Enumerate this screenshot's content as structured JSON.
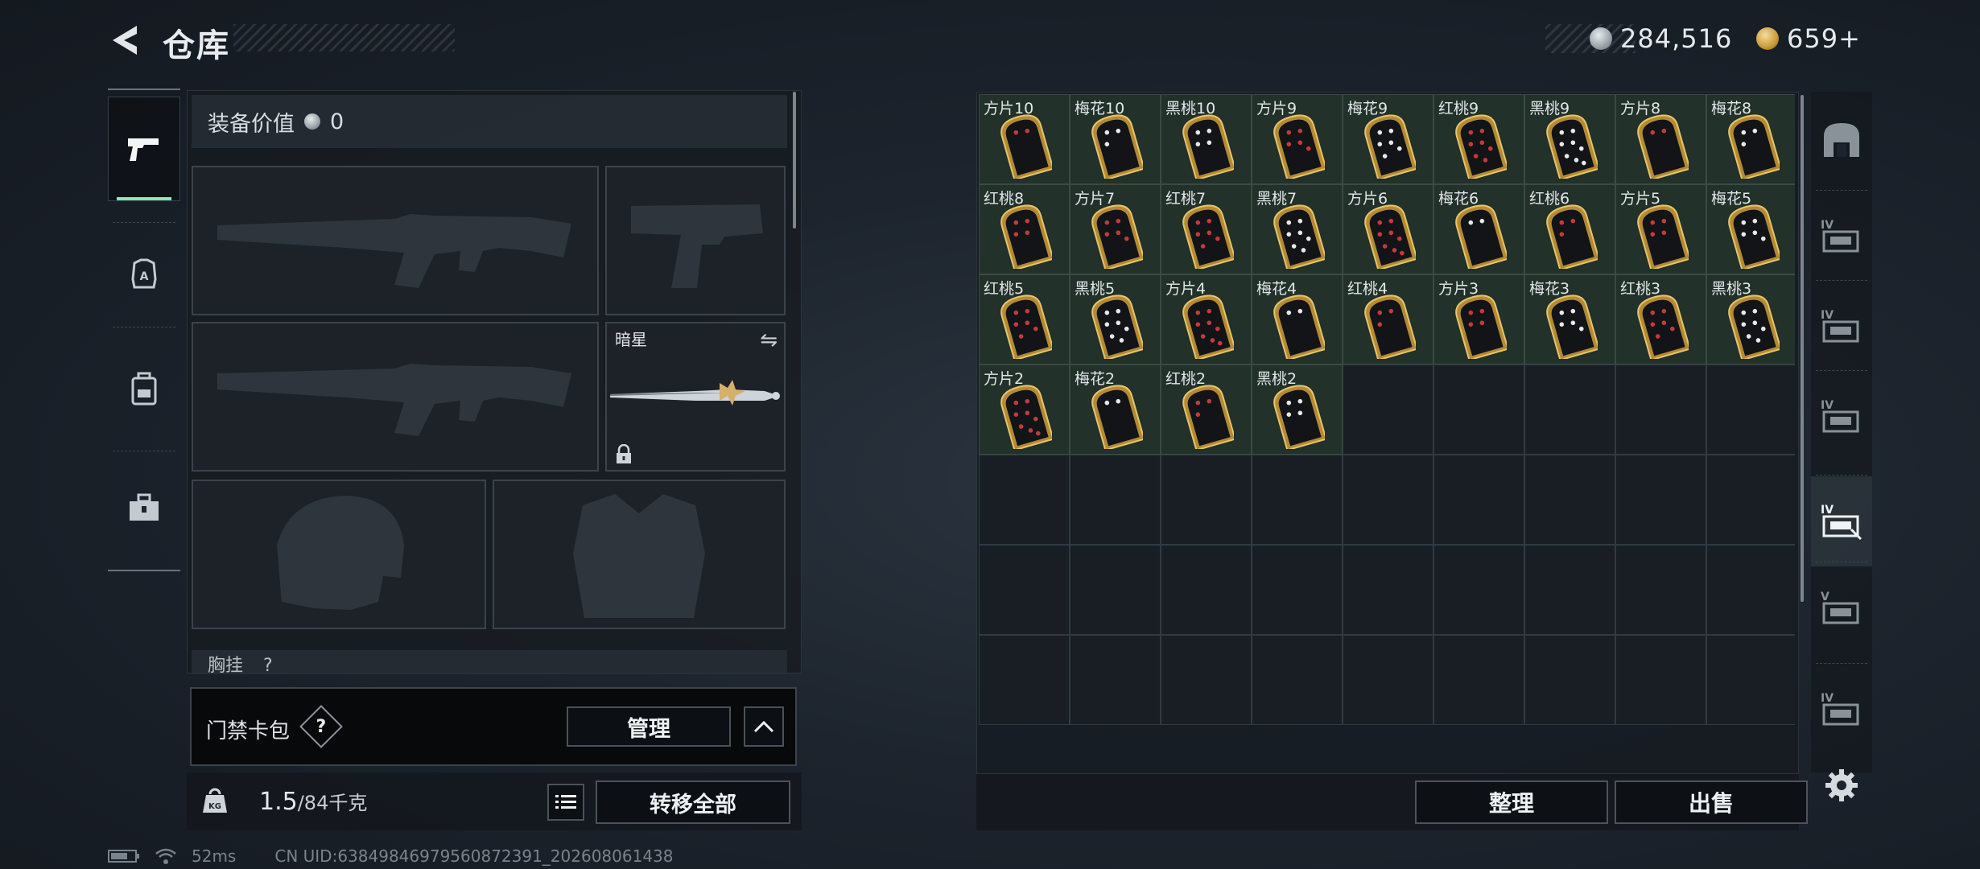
{
  "header": {
    "title": "仓库",
    "currency_silver": "284,516",
    "currency_gold": "659+"
  },
  "sidebar": {
    "items": [
      {
        "name": "weapons",
        "icon": "pistol-icon",
        "active": true
      },
      {
        "name": "armor",
        "icon": "armor-badge-icon",
        "active": false
      },
      {
        "name": "backpack",
        "icon": "backpack-icon",
        "active": false
      },
      {
        "name": "supplies",
        "icon": "toolbox-icon",
        "active": false
      }
    ]
  },
  "equipment": {
    "value_label": "装备价值",
    "value": "0",
    "melee_name": "暗星",
    "chest_label": "胸挂",
    "chest_help": "?"
  },
  "keycard_bag": {
    "label": "门禁卡包",
    "help": "?",
    "manage_label": "管理"
  },
  "weight": {
    "current": "1.5",
    "max_text": "/84千克",
    "transfer_all_label": "转移全部"
  },
  "storage": {
    "columns": 9,
    "total_cells": 63,
    "items": [
      {
        "name": "方片10",
        "suit": "diamond"
      },
      {
        "name": "梅花10",
        "suit": "club"
      },
      {
        "name": "黑桃10",
        "suit": "spade"
      },
      {
        "name": "方片9",
        "suit": "diamond"
      },
      {
        "name": "梅花9",
        "suit": "club"
      },
      {
        "name": "红桃9",
        "suit": "heart"
      },
      {
        "name": "黑桃9",
        "suit": "spade"
      },
      {
        "name": "方片8",
        "suit": "diamond"
      },
      {
        "name": "梅花8",
        "suit": "club"
      },
      {
        "name": "红桃8",
        "suit": "heart"
      },
      {
        "name": "方片7",
        "suit": "diamond"
      },
      {
        "name": "红桃7",
        "suit": "heart"
      },
      {
        "name": "黑桃7",
        "suit": "spade"
      },
      {
        "name": "方片6",
        "suit": "diamond"
      },
      {
        "name": "梅花6",
        "suit": "club"
      },
      {
        "name": "红桃6",
        "suit": "heart"
      },
      {
        "name": "方片5",
        "suit": "diamond"
      },
      {
        "name": "梅花5",
        "suit": "club"
      },
      {
        "name": "红桃5",
        "suit": "heart"
      },
      {
        "name": "黑桃5",
        "suit": "spade"
      },
      {
        "name": "方片4",
        "suit": "diamond"
      },
      {
        "name": "梅花4",
        "suit": "club"
      },
      {
        "name": "红桃4",
        "suit": "heart"
      },
      {
        "name": "方片3",
        "suit": "diamond"
      },
      {
        "name": "梅花3",
        "suit": "club"
      },
      {
        "name": "红桃3",
        "suit": "heart"
      },
      {
        "name": "黑桃3",
        "suit": "spade"
      },
      {
        "name": "方片2",
        "suit": "diamond"
      },
      {
        "name": "梅花2",
        "suit": "club"
      },
      {
        "name": "红桃2",
        "suit": "heart"
      },
      {
        "name": "黑桃2",
        "suit": "spade"
      }
    ],
    "sort_label": "整理",
    "sell_label": "出售"
  },
  "right_tabs": [
    {
      "icon": "safe-house-icon",
      "active": false
    },
    {
      "icon": "level-iv-weapon-case-icon",
      "active": false
    },
    {
      "icon": "level-iv-ammo-case-icon",
      "active": false
    },
    {
      "icon": "level-iv-ammo-case-2-icon",
      "active": false
    },
    {
      "icon": "level-iv-keycard-case-icon",
      "active": true
    },
    {
      "icon": "level-v-case-icon",
      "active": false
    },
    {
      "icon": "level-iv-case-icon",
      "active": false
    }
  ],
  "status": {
    "ping": "52ms",
    "uid": "CN UID:63849846979560872391_202608061438"
  },
  "colors": {
    "accent_green": "#8ee6b4",
    "card_gold": "#c9a24a",
    "cell_filled": "#223129"
  }
}
